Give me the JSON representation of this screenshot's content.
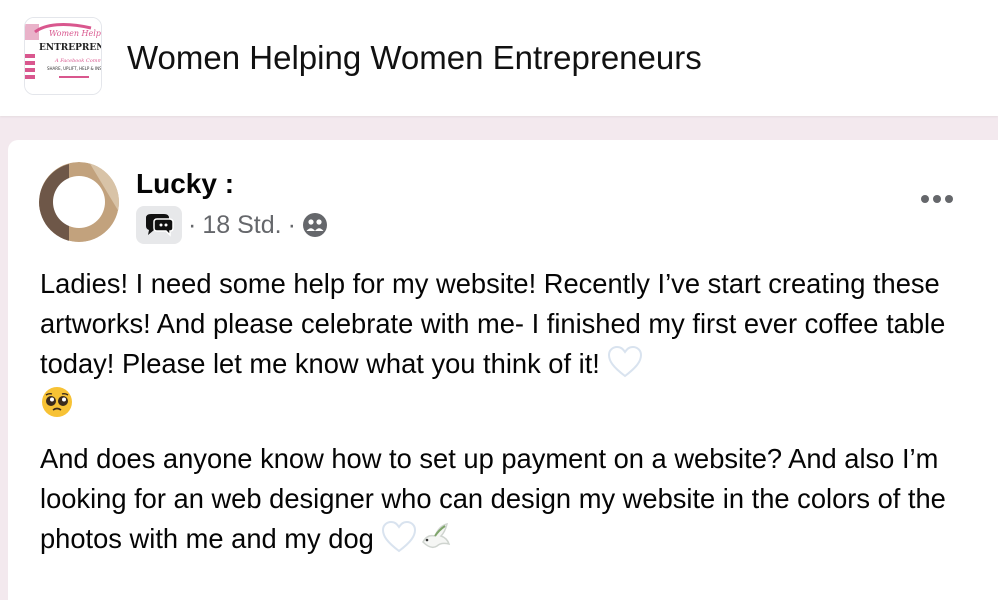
{
  "group": {
    "title": "Women Helping Women Entrepreneurs",
    "logo_icon": "group-cover-logo"
  },
  "post": {
    "author": "Lucky :",
    "time": "18 Std.",
    "separator": "·",
    "audience_icon": "group-members-icon",
    "more_icon": "more-options-icon",
    "paragraph1_text": "Ladies! I need some help for my website! Recently I’ve start creating these artworks! And please celebrate with me- I finished my first ever coffee table today! Please let me know what you think of it! ",
    "paragraph1_emojis": [
      "white-heart",
      "pleading-face"
    ],
    "paragraph2_text": "And does anyone know how to set up payment on a website? And also I’m looking for an web designer who can design my website in the colors of the photos with me and my dog ",
    "paragraph2_emojis": [
      "white-heart",
      "dove"
    ]
  },
  "colors": {
    "page_background": "#f3e9ee",
    "card_background": "#ffffff",
    "secondary_text": "#65676b"
  }
}
